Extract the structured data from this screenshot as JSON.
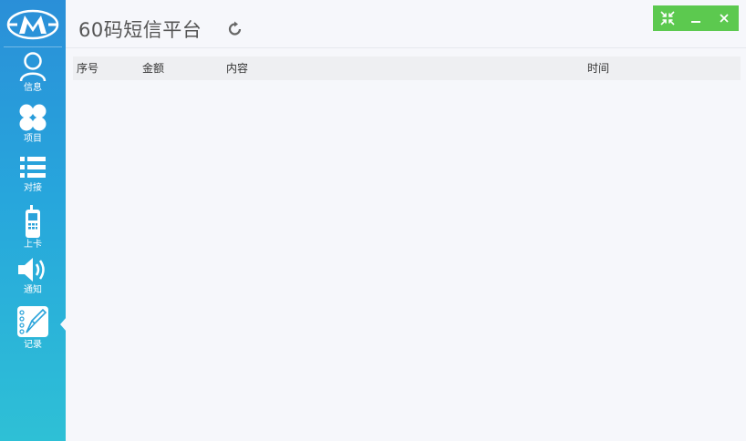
{
  "colors": {
    "sidebar_top": "#2a8fd8",
    "sidebar_bottom": "#2ec0d6",
    "window_controls": "#5cc94f",
    "background": "#f6f7fb"
  },
  "app": {
    "title": "60码短信平台"
  },
  "sidebar": {
    "items": [
      {
        "label": "信息",
        "icon": "user-icon"
      },
      {
        "label": "项目",
        "icon": "clover-icon"
      },
      {
        "label": "对接",
        "icon": "list-icon"
      },
      {
        "label": "上卡",
        "icon": "phone-icon"
      },
      {
        "label": "通知",
        "icon": "speaker-icon"
      },
      {
        "label": "记录",
        "icon": "notebook-icon"
      }
    ],
    "active_index": 5
  },
  "window": {
    "controls": [
      "restore-icon",
      "minimize-icon",
      "close-icon"
    ]
  },
  "table": {
    "columns": [
      "序号",
      "金额",
      "内容",
      "时间"
    ],
    "rows": []
  }
}
